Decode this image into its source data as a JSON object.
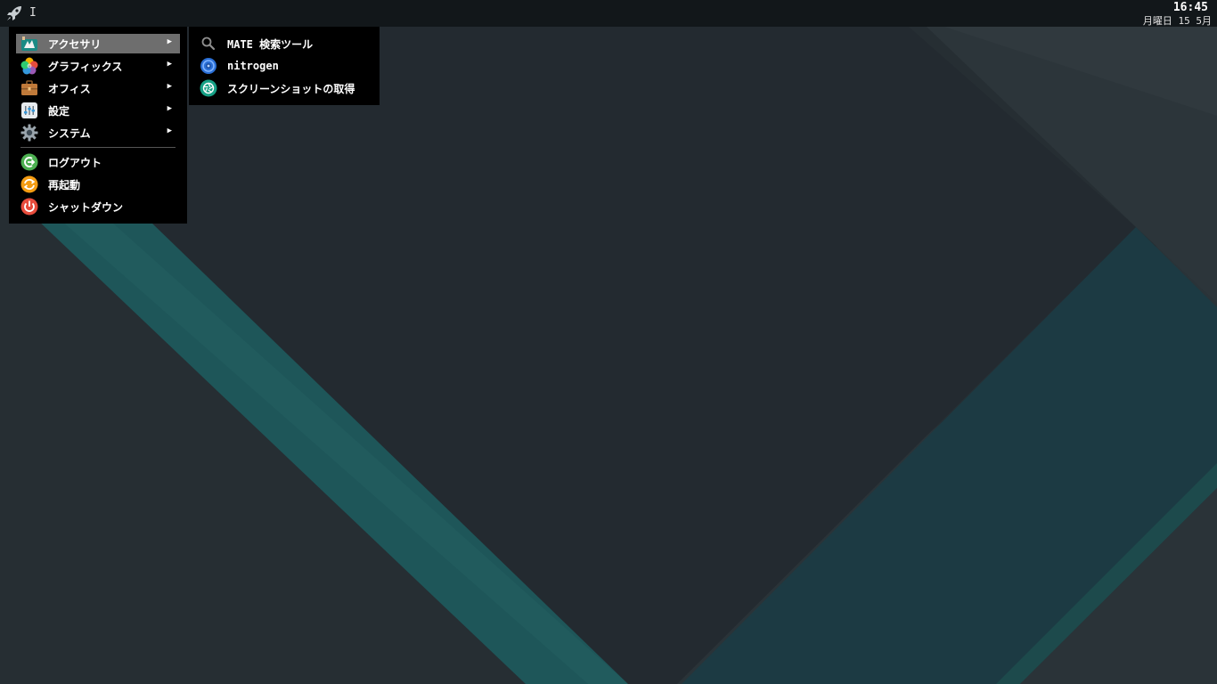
{
  "panel": {
    "input_indicator": "I",
    "clock_time": "16:45",
    "clock_date": "月曜日 15 5月"
  },
  "main_menu": {
    "items": [
      {
        "label": "アクセサリ",
        "icon": "accessories-icon",
        "has_submenu": true,
        "active": true
      },
      {
        "label": "グラフィックス",
        "icon": "graphics-icon",
        "has_submenu": true
      },
      {
        "label": "オフィス",
        "icon": "office-briefcase-icon",
        "has_submenu": true
      },
      {
        "label": "設定",
        "icon": "settings-icon",
        "has_submenu": true
      },
      {
        "label": "システム",
        "icon": "system-gear-icon",
        "has_submenu": true
      }
    ],
    "session_items": [
      {
        "label": "ログアウト",
        "icon": "logout-icon"
      },
      {
        "label": "再起動",
        "icon": "restart-icon"
      },
      {
        "label": "シャットダウン",
        "icon": "shutdown-icon"
      }
    ],
    "arrow_glyph": "▶"
  },
  "sub_menu": {
    "items": [
      {
        "label": "MATE 検索ツール",
        "icon": "search-icon"
      },
      {
        "label": "nitrogen",
        "icon": "nitrogen-icon"
      },
      {
        "label": "スクリーンショットの取得",
        "icon": "screenshot-icon"
      }
    ]
  },
  "colors": {
    "panel_bg": "#12171a",
    "menu_bg": "#000000",
    "active_item": "#6e6e6e",
    "wallpaper_teal": "#1f5b5d",
    "wallpaper_dark": "#23292f"
  }
}
